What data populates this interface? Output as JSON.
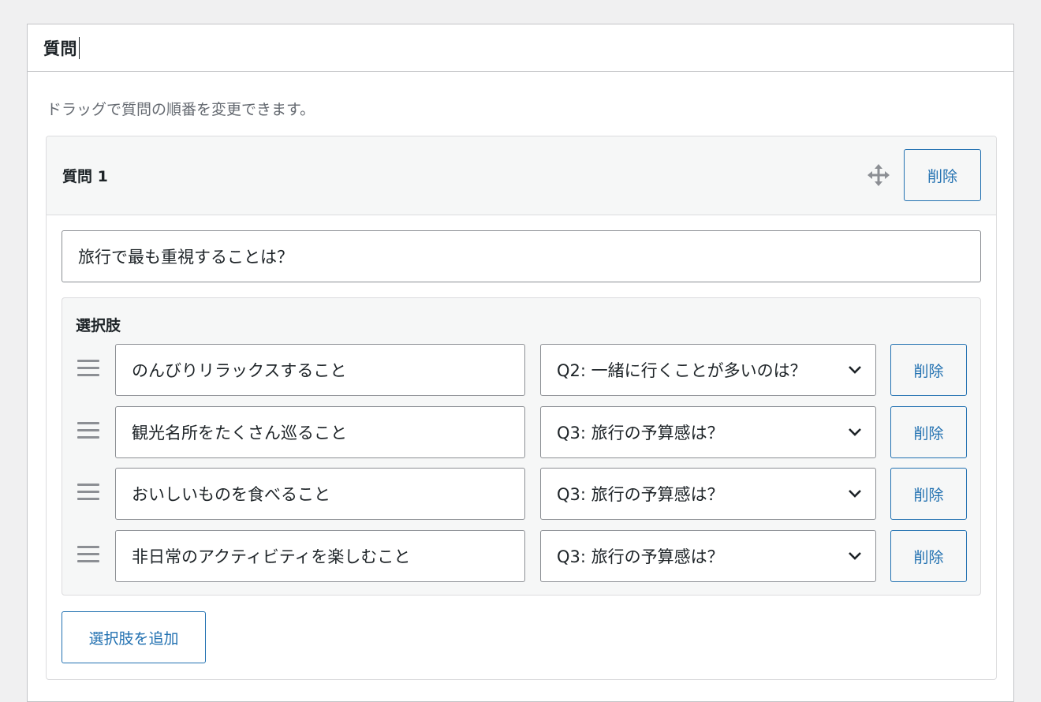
{
  "panel": {
    "title": "質問",
    "hint": "ドラッグで質問の順番を変更できます。"
  },
  "question": {
    "title": "質問 1",
    "delete_label": "削除",
    "text": "旅行で最も重視することは？",
    "choices_title": "選択肢",
    "choices": [
      {
        "text": "のんびりリラックスすること",
        "next": "Q2: 一緒に行くことが多いのは？",
        "delete_label": "削除"
      },
      {
        "text": "観光名所をたくさん巡ること",
        "next": "Q3: 旅行の予算感は？",
        "delete_label": "削除"
      },
      {
        "text": "おいしいものを食べること",
        "next": "Q3: 旅行の予算感は？",
        "delete_label": "削除"
      },
      {
        "text": "非日常のアクティビティを楽しむこと",
        "next": "Q3: 旅行の予算感は？",
        "delete_label": "削除"
      }
    ],
    "add_choice_label": "選択肢を追加"
  },
  "colors": {
    "accent": "#2271b1",
    "border": "#8c8f94",
    "background": "#f0f0f1",
    "panel_muted": "#f6f7f7"
  }
}
